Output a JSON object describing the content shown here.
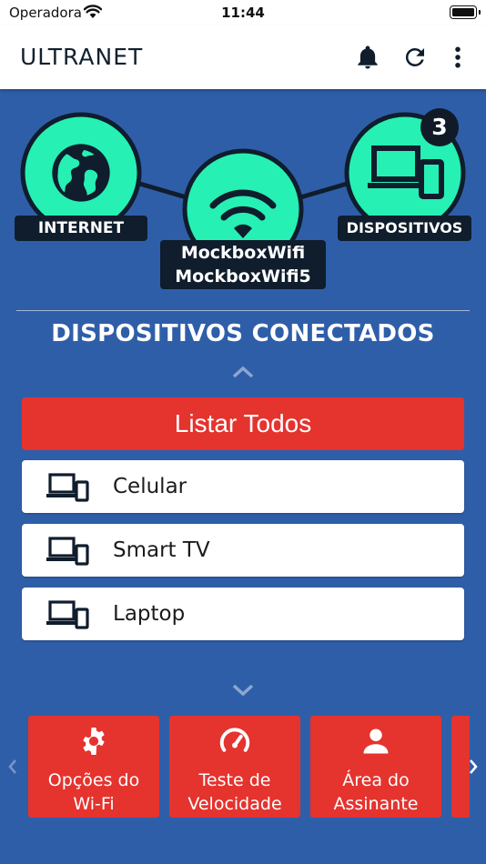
{
  "statusbar": {
    "carrier": "Operadora",
    "time": "11:44"
  },
  "appbar": {
    "title": "ULTRANET",
    "icons": [
      "bell-icon",
      "refresh-icon",
      "more-vertical-icon"
    ]
  },
  "topology": {
    "internet_label": "INTERNET",
    "wifi_ssids": [
      "MockboxWifi",
      "MockboxWifi5"
    ],
    "devices_label": "DISPOSITIVOS",
    "devices_count": "3",
    "colors": {
      "node": "#26f0b4",
      "outline": "#0f1d2c"
    }
  },
  "devices_section": {
    "title": "DISPOSITIVOS CONECTADOS",
    "list_all_label": "Listar Todos",
    "items": [
      {
        "label": "Celular",
        "icon": "devices-icon"
      },
      {
        "label": "Smart TV",
        "icon": "devices-icon"
      },
      {
        "label": "Laptop",
        "icon": "devices-icon"
      }
    ]
  },
  "menu": {
    "cards": [
      {
        "label_line1": "Opções do",
        "label_line2": "Wi-Fi",
        "icon": "gear-icon"
      },
      {
        "label_line1": "Teste de",
        "label_line2": "Velocidade",
        "icon": "speedometer-icon"
      },
      {
        "label_line1": "Área do",
        "label_line2": "Assinante",
        "icon": "user-icon"
      }
    ]
  },
  "colors": {
    "background": "#2f5ea9",
    "accent_red": "#e5332e",
    "white": "#ffffff"
  }
}
